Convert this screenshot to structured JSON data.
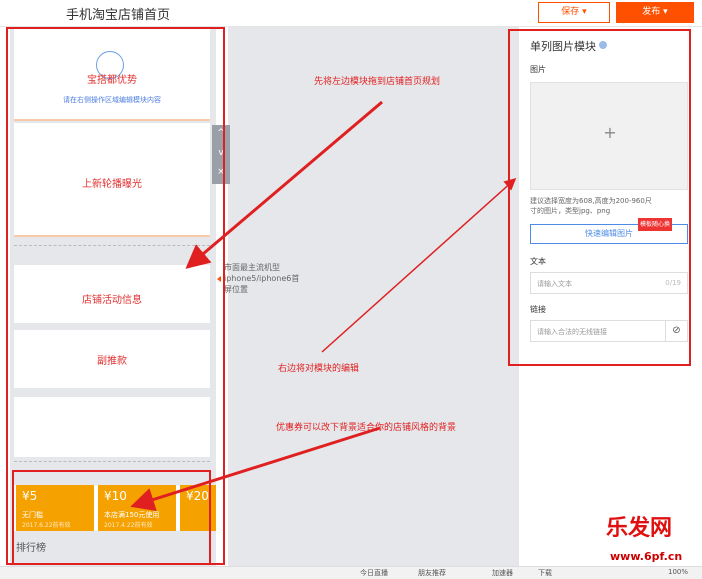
{
  "header": {
    "title": "手机淘宝店铺首页",
    "save_label": "保存",
    "publish_label": "发布"
  },
  "preview": {
    "hero_text": "宝搭都优势",
    "hero_subtext": "请在右侧操作区域编辑模块内容",
    "banner_text": "上新轮播曝光",
    "activity_text": "店铺活动信息",
    "sub_text": "副推款",
    "coupons": [
      {
        "amount": "¥5",
        "condition": "无门槛",
        "date": "2017.6.22前有效"
      },
      {
        "amount": "¥10",
        "condition": "本店满150元使用",
        "date": "2017.4.22前有效"
      },
      {
        "amount": "¥20",
        "condition": "",
        "date": ""
      }
    ],
    "rank_label": "排行榜",
    "device_hint": "市面最主流机型iphone5/iphone6首屏位置"
  },
  "side_tools": {
    "up": "^",
    "down": "v",
    "close": "×"
  },
  "panel": {
    "title": "单列图片模块",
    "image_label": "图片",
    "image_placeholder": "+",
    "image_note": "建议选择宽度为608,高度为200-960尺寸的图片，类型jpg、png",
    "quick_edit": "快速编辑图片",
    "tag": "模板随心换",
    "text_label": "文本",
    "text_placeholder": "请输入文本",
    "text_counter": "0/19",
    "link_label": "链接",
    "link_placeholder": "请输入合法的无线链接",
    "link_icon": "link-icon"
  },
  "annotations": {
    "drag": "先将左边模块拖到店铺首页规划",
    "edit": "右边将对模块的编辑",
    "coupon": "优惠券可以改下背景适合你的店铺风格的背景"
  },
  "statusbar": {
    "items": [
      "今日直播",
      "朋友推荐",
      "加速器",
      "下载",
      "100%"
    ]
  },
  "watermark": {
    "name": "乐发网",
    "url": "www.6pf.cn"
  },
  "colors": {
    "brand": "#ff5000",
    "coupon": "#f5a100",
    "annotation": "#e02020",
    "link": "#4d8be6"
  }
}
